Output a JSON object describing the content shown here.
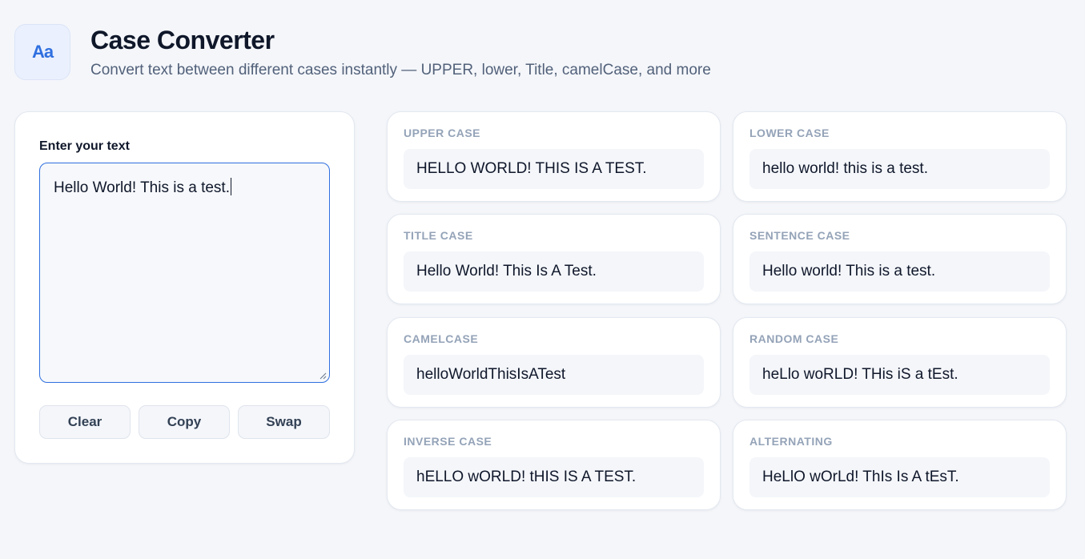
{
  "header": {
    "logo_text": "Aa",
    "title": "Case Converter",
    "subtitle": "Convert text between different cases instantly — UPPER, lower, Title, camelCase, and more"
  },
  "input": {
    "label": "Enter your text",
    "value": "Hello World! This is a test."
  },
  "buttons": {
    "clear": "Clear",
    "copy": "Copy",
    "swap": "Swap"
  },
  "results": [
    {
      "label": "UPPER CASE",
      "value": "HELLO WORLD! THIS IS A TEST."
    },
    {
      "label": "LOWER CASE",
      "value": "hello world! this is a test."
    },
    {
      "label": "TITLE CASE",
      "value": "Hello World! This Is A Test."
    },
    {
      "label": "SENTENCE CASE",
      "value": "Hello world! This is a test."
    },
    {
      "label": "CAMELCASE",
      "value": "helloWorldThisIsATest"
    },
    {
      "label": "RANDOM CASE",
      "value": "heLlo woRLD! THis iS a tEst."
    },
    {
      "label": "INVERSE CASE",
      "value": "hELLO wORLD! tHIS IS A TEST."
    },
    {
      "label": "ALTERNATING",
      "value": "HeLlO wOrLd! ThIs Is A tEsT."
    }
  ],
  "colors": {
    "accent": "#2f6fe0",
    "background": "#f4f6fa",
    "label_muted": "#94a3b8"
  }
}
